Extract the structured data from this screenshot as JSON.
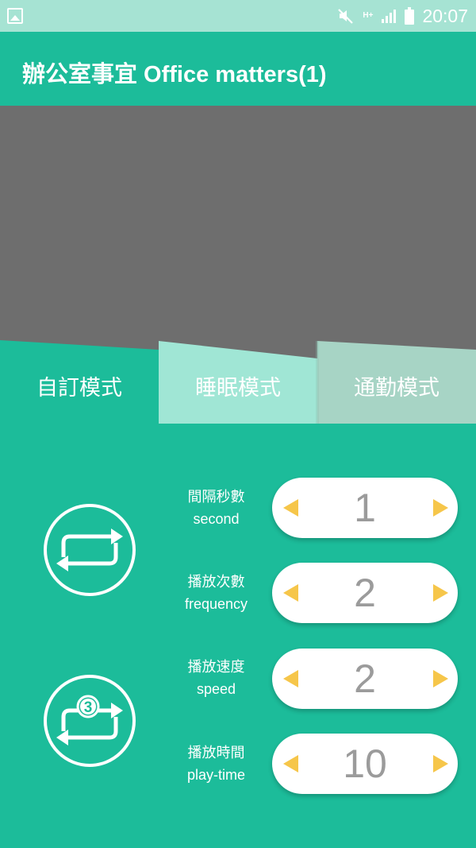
{
  "status_bar": {
    "time": "20:07",
    "network_label": "H+",
    "icons": [
      "image-icon",
      "mute-icon",
      "network-icon",
      "signal-icon",
      "battery-icon"
    ]
  },
  "app_bar": {
    "title": "辦公室事宜 Office matters(1)"
  },
  "tabs": [
    {
      "label": "自訂模式",
      "selected": true
    },
    {
      "label": "睡眠模式",
      "selected": false
    },
    {
      "label": "通勤模式",
      "selected": false
    }
  ],
  "mode_icons": [
    "repeat-icon",
    "repeat-3-icon"
  ],
  "repeat_count_badge": "3",
  "settings": [
    {
      "label_zh": "間隔秒數",
      "label_en": "second",
      "value": "1"
    },
    {
      "label_zh": "播放次數",
      "label_en": "frequency",
      "value": "2"
    },
    {
      "label_zh": "播放速度",
      "label_en": "speed",
      "value": "2"
    },
    {
      "label_zh": "播放時間",
      "label_en": "play-time",
      "value": "10"
    }
  ],
  "colors": {
    "primary": "#1cbc9a",
    "status_bar": "#a6e3d3",
    "tab_sleep": "#a0e6d5",
    "tab_commute": "#a7d4c5",
    "preview": "#6e6e6e",
    "arrow": "#f6c64a",
    "value_text": "#9b9b9b"
  }
}
